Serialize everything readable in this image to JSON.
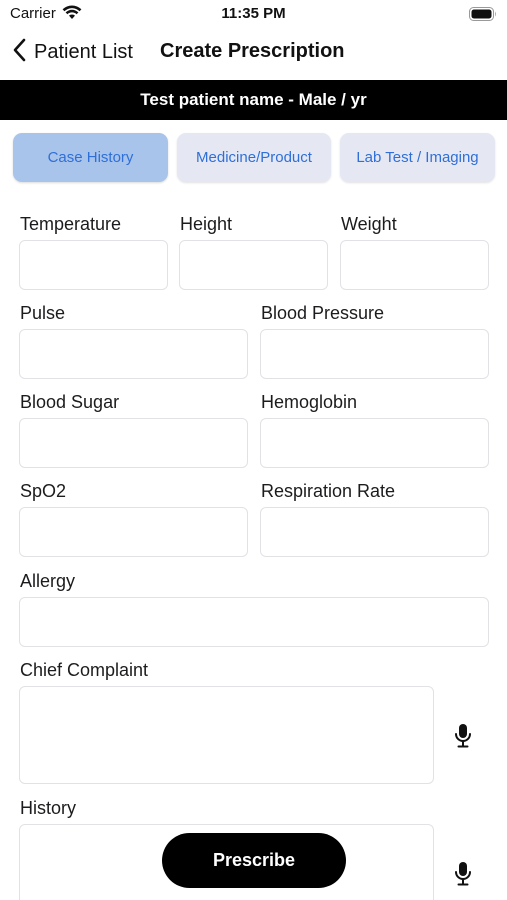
{
  "status_bar": {
    "carrier": "Carrier",
    "time": "11:35 PM"
  },
  "nav": {
    "back_label": "Patient List",
    "title": "Create Prescription"
  },
  "patient_banner": "Test patient name - Male /  yr",
  "tabs": [
    {
      "label": "Case History",
      "active": true
    },
    {
      "label": "Medicine/Product",
      "active": false
    },
    {
      "label": "Lab Test / Imaging",
      "active": false
    }
  ],
  "form": {
    "temperature": {
      "label": "Temperature",
      "value": ""
    },
    "height": {
      "label": "Height",
      "value": ""
    },
    "weight": {
      "label": "Weight",
      "value": ""
    },
    "pulse": {
      "label": "Pulse",
      "value": ""
    },
    "blood_pressure": {
      "label": "Blood Pressure",
      "value": ""
    },
    "blood_sugar": {
      "label": "Blood Sugar",
      "value": ""
    },
    "hemoglobin": {
      "label": "Hemoglobin",
      "value": ""
    },
    "spo2": {
      "label": "SpO2",
      "value": ""
    },
    "respiration_rate": {
      "label": "Respiration Rate",
      "value": ""
    },
    "allergy": {
      "label": "Allergy",
      "value": ""
    },
    "chief_complaint": {
      "label": "Chief Complaint",
      "value": ""
    },
    "history": {
      "label": "History",
      "value": ""
    }
  },
  "prescribe_button": "Prescribe",
  "icons": {
    "back": "chevron-left-icon",
    "wifi": "wifi-icon",
    "battery": "battery-icon",
    "mic": "microphone-icon"
  },
  "colors": {
    "tab_active_bg": "#a9c4ea",
    "tab_inactive_bg": "#e5e8f3",
    "tab_text": "#2f6fd8",
    "banner_bg": "#000000",
    "button_bg": "#000000"
  }
}
